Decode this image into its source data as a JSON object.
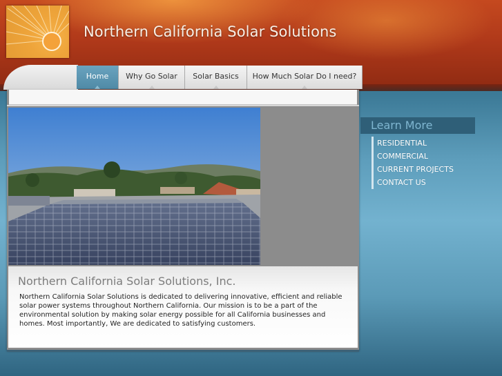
{
  "header": {
    "site_title": "Northern California Solar Solutions"
  },
  "nav": {
    "tabs": [
      {
        "label": "Home",
        "active": true
      },
      {
        "label": "Why Go Solar",
        "active": false
      },
      {
        "label": "Solar Basics",
        "active": false
      },
      {
        "label": "How Much Solar Do I need?",
        "active": false
      }
    ]
  },
  "main": {
    "company_name": "Northern California Solar Solutions, Inc.",
    "description": "Northern California Solar Solutions is dedicated to delivering innovative, efficient and reliable solar power systems throughout Northern California. Our mission is to be a part of the environmental solution by making solar energy possible for all California businesses and homes. Most importantly, We are dedicated to satisfying customers."
  },
  "sidebar": {
    "heading": "Learn More",
    "links": [
      "RESIDENTIAL",
      "COMMERCIAL",
      "CURRENT PROJECTS",
      "CONTACT US"
    ]
  },
  "colors": {
    "header_red": "#b0391a",
    "active_tab": "#5a94b0",
    "sidebar_heading_bg": "#2f5f78"
  }
}
